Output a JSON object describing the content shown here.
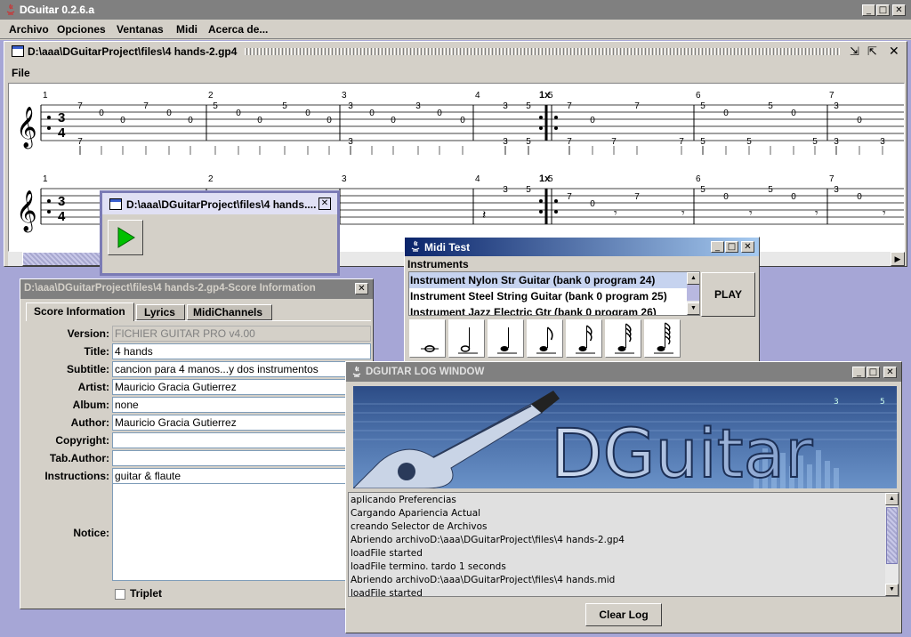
{
  "app": {
    "title": "DGuitar 0.2.6.a",
    "menu": [
      "Archivo",
      "Opciones",
      "Ventanas",
      "Midi",
      "Acerca de..."
    ]
  },
  "doc": {
    "title": "D:\\aaa\\DGuitarProject\\files\\4 hands-2.gp4",
    "menu": "File"
  },
  "score": {
    "measures": [
      "1",
      "2",
      "3",
      "4",
      "5",
      "6",
      "7"
    ],
    "repeat": "1x",
    "time_top": "3",
    "time_bottom": "4"
  },
  "player": {
    "title": "D:\\aaa\\DGuitarProject\\files\\4 hands...."
  },
  "info": {
    "title": "D:\\aaa\\DGuitarProject\\files\\4 hands-2.gp4-Score Information",
    "tabs": [
      "Score Information",
      "Lyrics",
      "MidiChannels"
    ],
    "fields": [
      {
        "label": "Version:",
        "value": "FICHIER GUITAR PRO v4.00"
      },
      {
        "label": "Title:",
        "value": "4 hands"
      },
      {
        "label": "Subtitle:",
        "value": "cancion para 4 manos...y dos instrumentos"
      },
      {
        "label": "Artist:",
        "value": "Mauricio Gracia Gutierrez"
      },
      {
        "label": "Album:",
        "value": "none"
      },
      {
        "label": "Author:",
        "value": "Mauricio Gracia Gutierrez"
      },
      {
        "label": "Copyright:",
        "value": ""
      },
      {
        "label": "Tab.Author:",
        "value": ""
      },
      {
        "label": "Instructions:",
        "value": "guitar & flaute"
      }
    ],
    "notice_label": "Notice:",
    "triplet": "Triplet"
  },
  "midi": {
    "title": "Midi Test",
    "instruments_label": "Instruments",
    "instruments": [
      "Instrument Nylon Str Guitar (bank 0 program 24)",
      "Instrument Steel String Guitar (bank 0 program 25)",
      "Instrument Jazz Electric Gtr (bank 0 program 26)"
    ],
    "play": "PLAY"
  },
  "log": {
    "title": "DGUITAR LOG WINDOW",
    "banner": "DGuitar",
    "lines": [
      "aplicando Preferencias",
      "Cargando Apariencia Actual",
      "creando Selector de Archivos",
      "Abriendo archivoD:\\aaa\\DGuitarProject\\files\\4 hands-2.gp4",
      "loadFile started",
      "loadFile termino. tardo 1 seconds",
      "Abriendo archivoD:\\aaa\\DGuitarProject\\files\\4 hands.mid",
      "loadFile started"
    ],
    "clear": "Clear Log"
  }
}
